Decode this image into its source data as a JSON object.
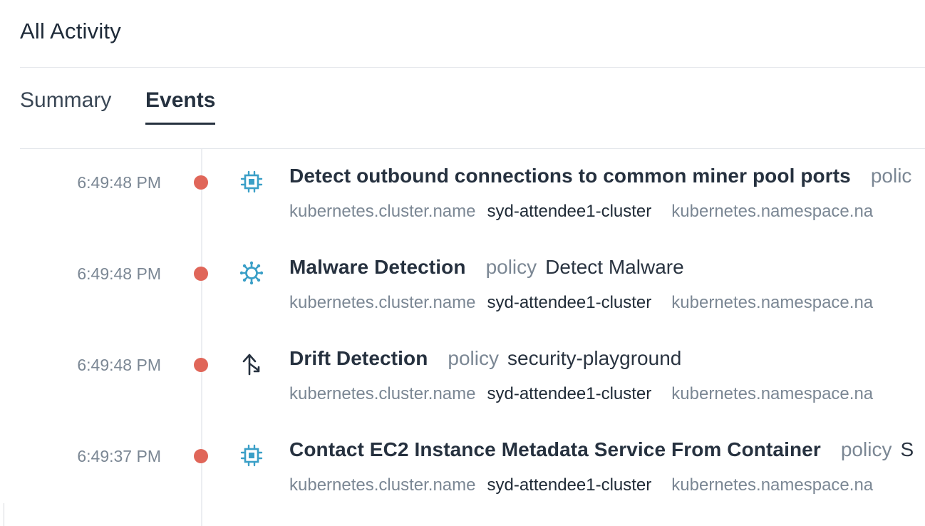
{
  "page": {
    "title": "All Activity"
  },
  "tabs": [
    {
      "label": "Summary",
      "active": false
    },
    {
      "label": "Events",
      "active": true
    }
  ],
  "colors": {
    "dot": "#e06659",
    "icon_accent": "#3a9fc7",
    "icon_dark": "#26313f"
  },
  "events": [
    {
      "time": "6:49:48 PM",
      "icon": "chip-icon",
      "title": "Detect outbound connections to common miner pool ports",
      "policy_key": "polic",
      "policy_value": "",
      "tags": {
        "k1": "kubernetes.cluster.name",
        "v1": "syd-attendee1-cluster",
        "k2": "kubernetes.namespace.na"
      }
    },
    {
      "time": "6:49:48 PM",
      "icon": "virus-icon",
      "title": "Malware Detection",
      "policy_key": "policy",
      "policy_value": "Detect Malware",
      "tags": {
        "k1": "kubernetes.cluster.name",
        "v1": "syd-attendee1-cluster",
        "k2": "kubernetes.namespace.na"
      }
    },
    {
      "time": "6:49:48 PM",
      "icon": "drift-arrow-icon",
      "title": "Drift Detection",
      "policy_key": "policy",
      "policy_value": "security-playground",
      "tags": {
        "k1": "kubernetes.cluster.name",
        "v1": "syd-attendee1-cluster",
        "k2": "kubernetes.namespace.na"
      }
    },
    {
      "time": "6:49:37 PM",
      "icon": "chip-icon",
      "title": "Contact EC2 Instance Metadata Service From Container",
      "policy_key": "policy",
      "policy_value": "S",
      "tags": {
        "k1": "kubernetes.cluster.name",
        "v1": "syd-attendee1-cluster",
        "k2": "kubernetes.namespace.na"
      }
    }
  ]
}
